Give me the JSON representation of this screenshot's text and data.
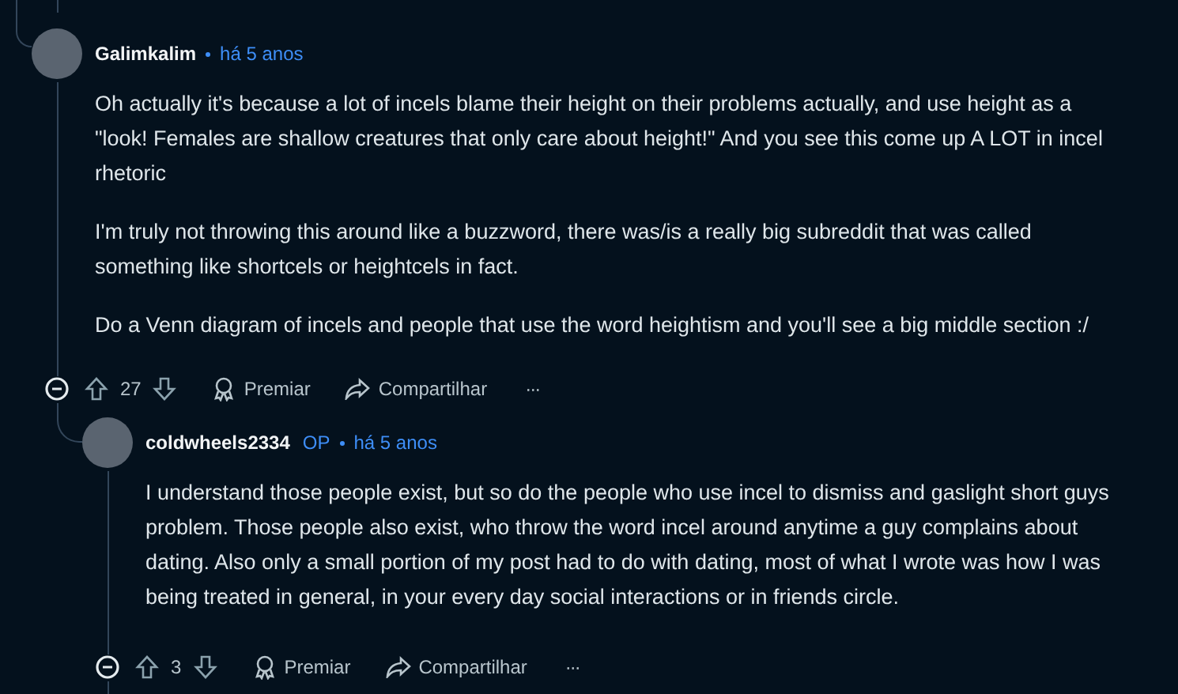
{
  "comments": [
    {
      "author": "Galimkalim",
      "time": "há 5 anos",
      "paragraphs": [
        "Oh actually it's because a lot of incels blame their height on their problems actually, and use height as a \"look! Females are shallow creatures that only care about height!\" And you see this come up A LOT in incel rhetoric",
        "I'm truly not throwing this around like a buzzword, there was/is a really big subreddit that was called something like shortcels or heightcels in fact.",
        "Do a Venn diagram of incels and people that use the word heightism and you'll see a big middle section :/"
      ],
      "score": "27",
      "award": "Premiar",
      "share": "Compartilhar",
      "more": "···"
    },
    {
      "author": "coldwheels2334",
      "op_badge": "OP",
      "time": "há 5 anos",
      "paragraphs": [
        "I understand those people exist, but so do the people who use incel to dismiss and gaslight short guys problem. Those people also exist, who throw the word incel around anytime a guy complains about dating. Also only a small portion of my post had to do with dating, most of what I wrote was how I was being treated in general, in your every day social interactions or in friends circle."
      ],
      "score": "3",
      "award": "Premiar",
      "share": "Compartilhar",
      "more": "···"
    }
  ]
}
